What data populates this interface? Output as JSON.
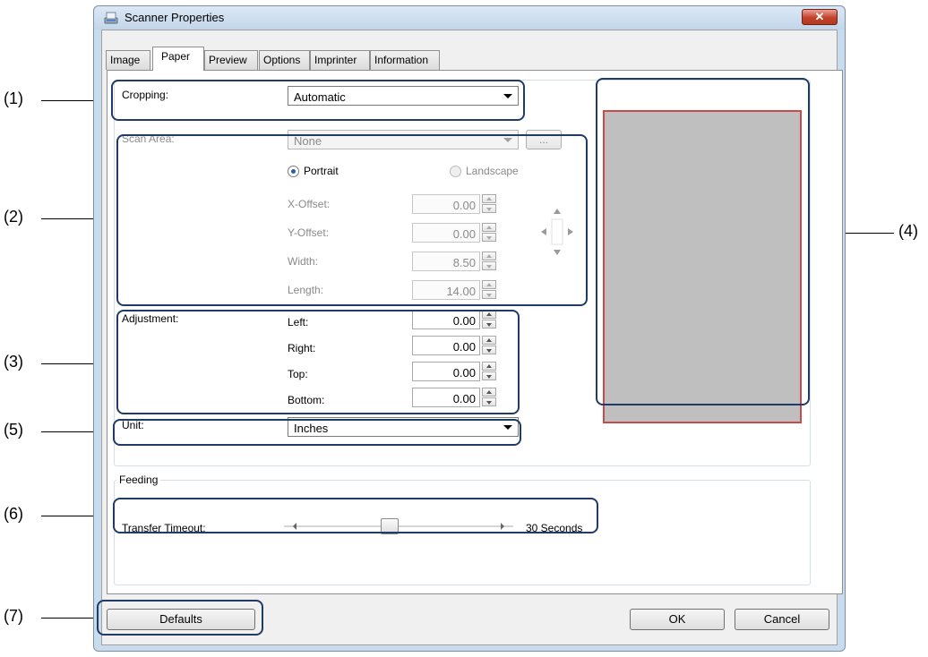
{
  "window": {
    "title": "Scanner Properties"
  },
  "tabs": [
    {
      "label": "Image"
    },
    {
      "label": "Paper"
    },
    {
      "label": "Preview"
    },
    {
      "label": "Options"
    },
    {
      "label": "Imprinter"
    },
    {
      "label": "Information"
    }
  ],
  "active_tab": "Paper",
  "cropping": {
    "label": "Cropping:",
    "value": "Automatic"
  },
  "scan_area": {
    "label": "Scan Area:",
    "value": "None",
    "more_button": "...",
    "orientation": {
      "portrait": "Portrait",
      "landscape": "Landscape",
      "selected": "Portrait"
    },
    "x_offset": {
      "label": "X-Offset:",
      "value": "0.00"
    },
    "y_offset": {
      "label": "Y-Offset:",
      "value": "0.00"
    },
    "width": {
      "label": "Width:",
      "value": "8.50"
    },
    "length": {
      "label": "Length:",
      "value": "14.00"
    }
  },
  "adjustment": {
    "label": "Adjustment:",
    "left": {
      "label": "Left:",
      "value": "0.00"
    },
    "right": {
      "label": "Right:",
      "value": "0.00"
    },
    "top": {
      "label": "Top:",
      "value": "0.00"
    },
    "bottom": {
      "label": "Bottom:",
      "value": "0.00"
    }
  },
  "unit": {
    "label": "Unit:",
    "value": "Inches"
  },
  "feeding": {
    "title": "Feeding",
    "transfer_timeout": {
      "label": "Transfer Timeout:",
      "value_text": "30 Seconds",
      "slider_fraction": 0.45
    }
  },
  "buttons": {
    "defaults": "Defaults",
    "ok": "OK",
    "cancel": "Cancel",
    "close": "✕"
  },
  "callouts": [
    "(1)",
    "(2)",
    "(3)",
    "(4)",
    "(5)",
    "(6)",
    "(7)"
  ],
  "colors": {
    "highlight": "#1f3b66",
    "preview_border": "#c94a4a",
    "preview_fill": "#bfbfbf"
  },
  "icons": {
    "app": "scanner-icon",
    "close": "close-icon"
  }
}
